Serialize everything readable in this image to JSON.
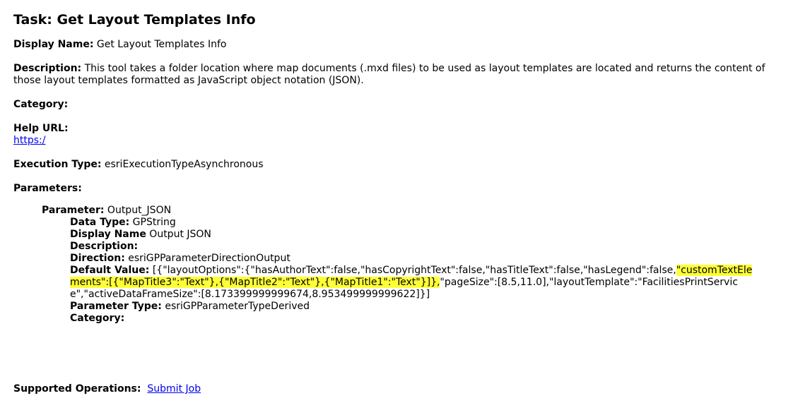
{
  "page": {
    "title": "Task: Get Layout Templates Info"
  },
  "display_name": {
    "label": "Display Name:",
    "value": "Get Layout Templates Info"
  },
  "description": {
    "label": "Description:",
    "value": "This tool takes a folder location where map documents (.mxd files) to be used as layout templates are located and returns the content of those layout templates formatted as JavaScript object notation (JSON)."
  },
  "category": {
    "label": "Category:",
    "value": ""
  },
  "help_url": {
    "label": "Help URL:",
    "link_text": "https:/"
  },
  "execution_type": {
    "label": "Execution Type:",
    "value": "esriExecutionTypeAsynchronous"
  },
  "parameters": {
    "label": "Parameters:",
    "parameter": {
      "label": "Parameter:",
      "name": "Output_JSON",
      "data_type_label": "Data Type:",
      "data_type": "GPString",
      "display_name_label": "Display Name",
      "display_name": "Output JSON",
      "description_label": "Description:",
      "description": "",
      "direction_label": "Direction:",
      "direction": "esriGPParameterDirectionOutput",
      "default_value_label": "Default Value:",
      "default_value_part1": "[{\"layoutOptions\":{\"hasAuthorText\":false,\"hasCopyrightText\":false,\"hasTitleText\":false,\"hasLegend\":false,",
      "default_value_highlight": "\"customTextElements\":[{\"MapTitle3\":\"Text\"},{\"MapTitle2\":\"Text\"},{\"MapTitle1\":\"Text\"}]},",
      "default_value_part3": "\"pageSize\":[8.5,11.0],\"layoutTemplate\":\"FacilitiesPrintService\",\"activeDataFrameSize\":[8.173399999999674,8.953499999999622]}]",
      "parameter_type_label": "Parameter Type:",
      "parameter_type": "esriGPParameterTypeDerived",
      "category_label": "Category:",
      "category": ""
    }
  },
  "supported_operations": {
    "label": "Supported Operations:",
    "link_text": "Submit Job"
  },
  "colors": {
    "highlight": "#ffff38",
    "link": "#0000ee"
  }
}
